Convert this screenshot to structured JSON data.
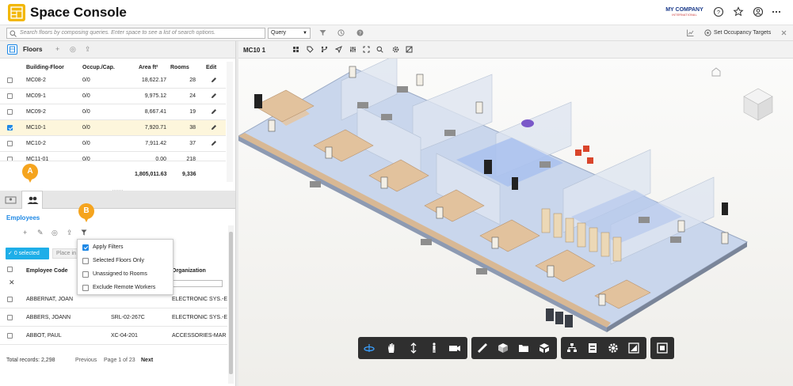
{
  "header": {
    "title": "Space Console",
    "company_name": "MY COMPANY",
    "company_sub": "INTERNATIONAL"
  },
  "search": {
    "placeholder": "Search floors by composing queries. Enter space to see a list of search options.",
    "query_label": "Query",
    "occupancy_label": "Set Occupancy Targets"
  },
  "floors": {
    "title": "Floors",
    "columns": [
      "Building-Floor",
      "Occup./Cap.",
      "Area ft²",
      "Rooms",
      "Edit"
    ],
    "rows": [
      {
        "floor": "MC08-2",
        "occ": "0/0",
        "area": "18,622.17",
        "rooms": "28",
        "selected": false
      },
      {
        "floor": "MC09-1",
        "occ": "0/0",
        "area": "9,975.12",
        "rooms": "24",
        "selected": false
      },
      {
        "floor": "MC09-2",
        "occ": "0/0",
        "area": "8,667.41",
        "rooms": "19",
        "selected": false
      },
      {
        "floor": "MC10-1",
        "occ": "0/0",
        "area": "7,920.71",
        "rooms": "38",
        "selected": true
      },
      {
        "floor": "MC10-2",
        "occ": "0/0",
        "area": "7,911.42",
        "rooms": "37",
        "selected": false
      },
      {
        "floor": "MC11-01",
        "occ": "0/0",
        "area": "0.00",
        "rooms": "218",
        "selected": false
      }
    ],
    "total_area": "1,805,011.63",
    "total_rooms": "9,336"
  },
  "employees": {
    "title": "Employees",
    "selected_label": "0 selected",
    "place_label": "Place in Room",
    "columns": [
      "Employee Code",
      "Room",
      "Organization"
    ],
    "rows": [
      {
        "name": "ABBERNAT, JOAN",
        "room": "",
        "org": "ELECTRONIC SYS.-E"
      },
      {
        "name": "ABBERS, JOANN",
        "room": "SRL-02-267C",
        "org": "ELECTRONIC SYS.-E"
      },
      {
        "name": "ABBOT, PAUL",
        "room": "XC-04-201",
        "org": "ACCESSORIES-MAR"
      }
    ],
    "total_records": "Total records: 2,298",
    "prev": "Previous",
    "page": "Page 1 of 23",
    "next": "Next"
  },
  "filter_menu": {
    "items": [
      {
        "label": "Apply Filters",
        "checked": true
      },
      {
        "label": "Selected Floors Only",
        "checked": false
      },
      {
        "label": "Unassigned to Rooms",
        "checked": false
      },
      {
        "label": "Exclude Remote Workers",
        "checked": false
      }
    ]
  },
  "callouts": {
    "a": "A",
    "b": "B"
  },
  "viewer": {
    "title": "MC10 1"
  },
  "colors": {
    "accent": "#1e88e5",
    "logo": "#f2b705",
    "callout": "#f5a41e",
    "selected_row": "#fdf6dc",
    "badge": "#1eaee8"
  }
}
